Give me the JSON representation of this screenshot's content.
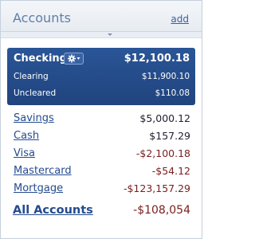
{
  "header": {
    "title": "Accounts",
    "add_label": "add"
  },
  "selected_account": {
    "name": "Checking",
    "total": "$12,100.18",
    "rows": [
      {
        "label": "Clearing",
        "value": "$11,900.10"
      },
      {
        "label": "Uncleared",
        "value": "$110.08"
      }
    ],
    "menu_icon": "gear-icon"
  },
  "accounts": [
    {
      "name": "Savings",
      "value": "$5,000.12",
      "negative": false
    },
    {
      "name": "Cash",
      "value": "$157.29",
      "negative": false
    },
    {
      "name": "Visa",
      "value": "-$2,100.18",
      "negative": true
    },
    {
      "name": "Mastercard",
      "value": "-$54.12",
      "negative": true
    },
    {
      "name": "Mortgage",
      "value": "-$123,157.29",
      "negative": true
    }
  ],
  "all_accounts": {
    "label": "All Accounts",
    "value": "-$108,054"
  },
  "colors": {
    "selected_bg": "#244b8f",
    "link": "#244b8f",
    "negative": "#7a1e1e",
    "title": "#5f7fa8"
  }
}
